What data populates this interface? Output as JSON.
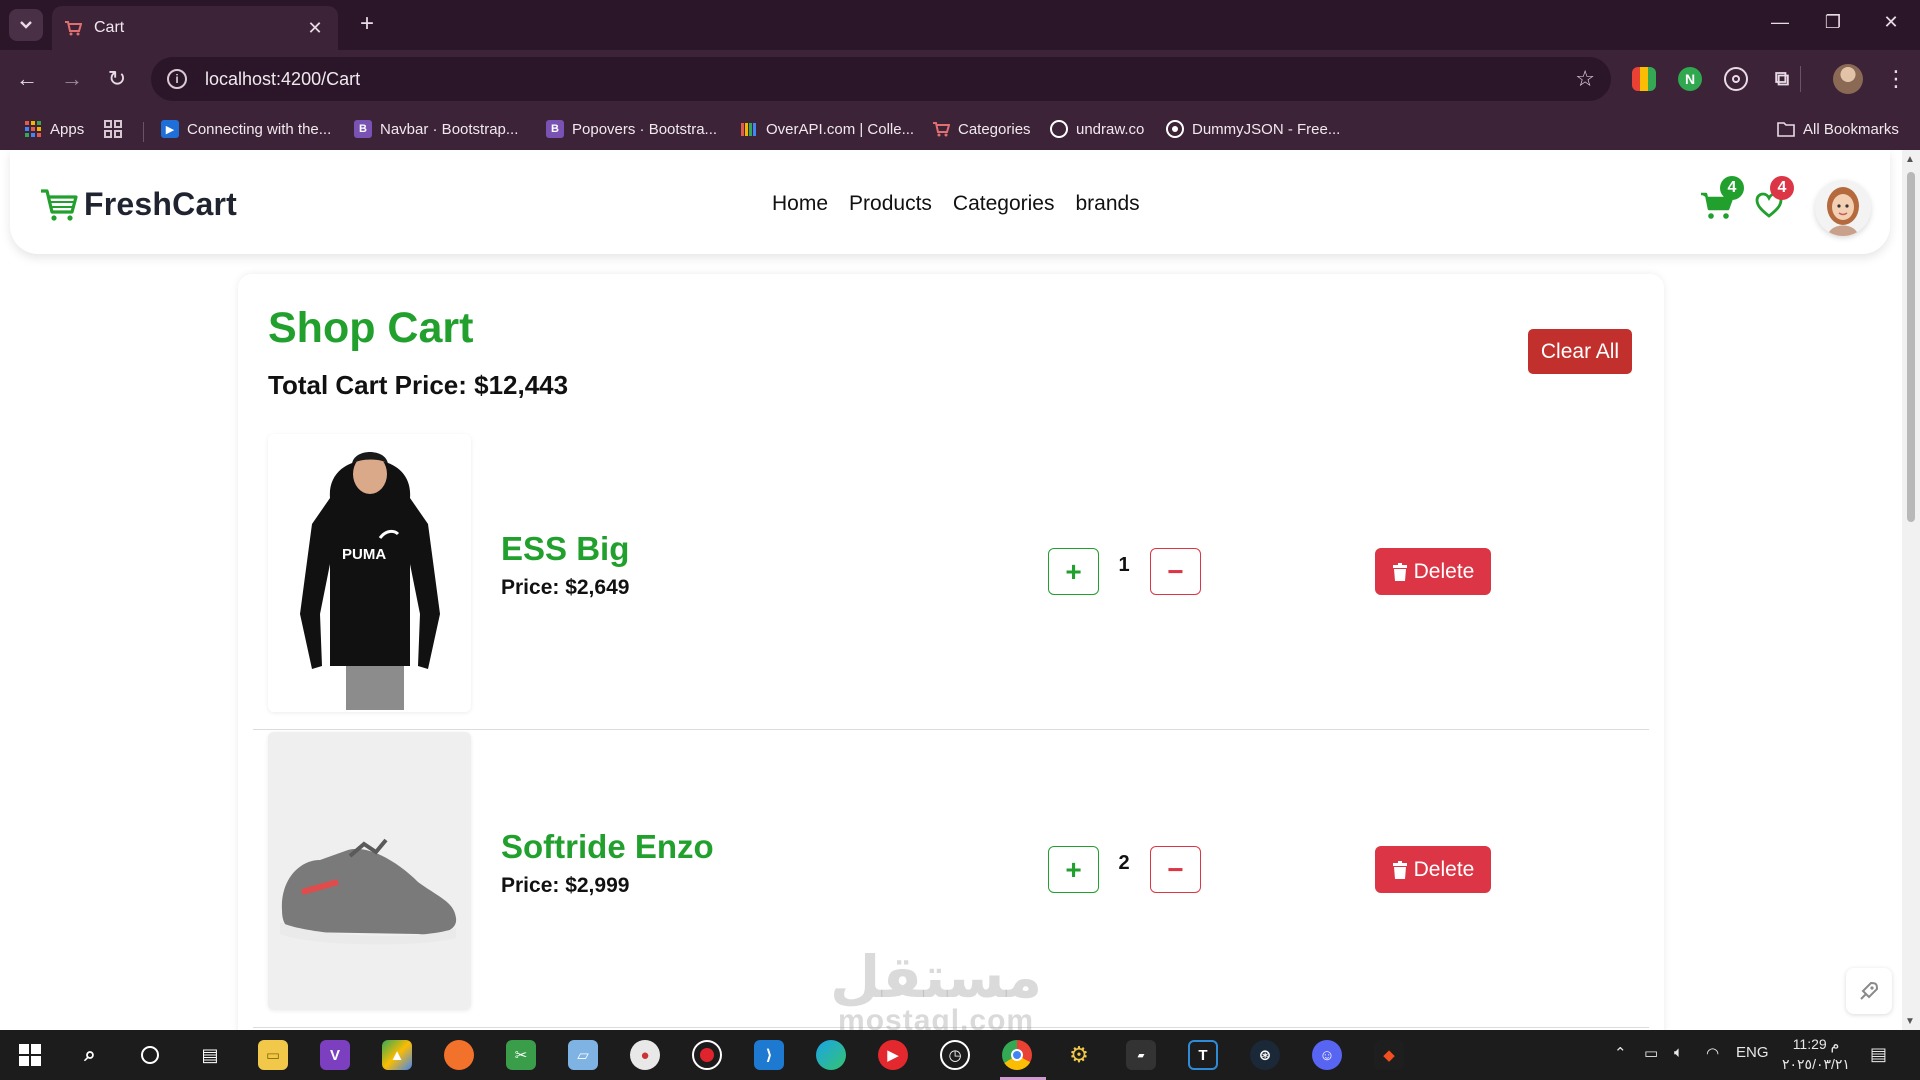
{
  "browser": {
    "tab_title": "Cart",
    "url": "localhost:4200/Cart",
    "bookmarks": [
      {
        "label": "Apps",
        "icon": "apps-grid-icon",
        "color": "#e05a4e"
      },
      {
        "label": "",
        "icon": "grid-icon",
        "color": "#cfcfcf"
      },
      {
        "label": "Connecting with the...",
        "icon": "video-icon",
        "color": "#1e6fd8"
      },
      {
        "label": "Navbar · Bootstrap...",
        "icon": "bootstrap-icon",
        "color": "#7952b3"
      },
      {
        "label": "Popovers · Bootstra...",
        "icon": "bootstrap-icon",
        "color": "#7952b3"
      },
      {
        "label": "OverAPI.com | Colle...",
        "icon": "overapi-icon",
        "color": "#e0a030"
      },
      {
        "label": "Categories",
        "icon": "cart-favicon",
        "color": "#d05050"
      },
      {
        "label": "undraw.co",
        "icon": "undraw-icon",
        "color": "#ffffff"
      },
      {
        "label": "DummyJSON - Free...",
        "icon": "dummyjson-icon",
        "color": "#ffffff"
      }
    ],
    "all_bookmarks_label": "All Bookmarks"
  },
  "nav": {
    "brand": "FreshCart",
    "links": [
      "Home",
      "Products",
      "Categories",
      "brands"
    ],
    "cart_count": "4",
    "wishlist_count": "4"
  },
  "cart": {
    "title": "Shop Cart",
    "total_label": "Total Cart Price: $12,443",
    "clear_label": "Clear All",
    "items": [
      {
        "name": "ESS Big",
        "price_label": "Price: $2,649",
        "qty": "1",
        "delete_label": "Delete",
        "image": "black-hoodie"
      },
      {
        "name": "Softride Enzo",
        "price_label": "Price: $2,999",
        "qty": "2",
        "delete_label": "Delete",
        "image": "grey-sneaker"
      }
    ]
  },
  "watermark": {
    "arabic": "مستقل",
    "latin": "mostaql.com"
  },
  "taskbar": {
    "tray_lang": "ENG",
    "time": "11:29 م",
    "date": "٢٠٢٥/٠٣/٢١"
  },
  "colors": {
    "brand_green": "#22a02d",
    "danger_red": "#dc3545",
    "clear_red": "#c2302e",
    "chrome_bg": "#3c2338"
  }
}
